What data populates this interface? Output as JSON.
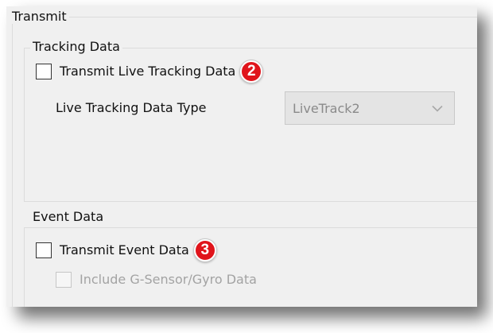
{
  "transmit": {
    "title": "Transmit",
    "tracking": {
      "title": "Tracking Data",
      "checkbox_label": "Transmit Live Tracking Data",
      "checked": false,
      "badge": "2",
      "type_label": "Live Tracking Data Type",
      "type_value": "LiveTrack2",
      "type_enabled": false
    },
    "event": {
      "title": "Event Data",
      "checkbox_label": "Transmit Event Data",
      "checked": false,
      "badge": "3",
      "sub_checkbox_label": "Include G-Sensor/Gyro Data",
      "sub_checked": false,
      "sub_enabled": false
    }
  },
  "colors": {
    "badge": "#e0141b",
    "panel": "#f0f0f0",
    "disabled_text": "#a3a3a3"
  },
  "icons": {
    "badge_2": "number-badge-icon",
    "badge_3": "number-badge-icon",
    "dropdown": "chevron-down-icon"
  }
}
